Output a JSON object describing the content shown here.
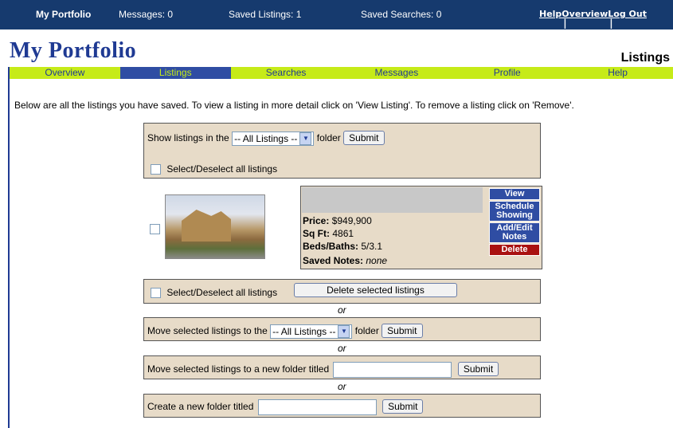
{
  "topbar": {
    "brand": "My Portfolio",
    "messages": "Messages: 0",
    "saved_listings": "Saved Listings: 1",
    "saved_searches": "Saved Searches: 0",
    "help": "Help",
    "overview": "Overview",
    "logout": "Log Out",
    "sep": "|"
  },
  "page": {
    "title": "My Portfolio",
    "section": "Listings"
  },
  "nav": [
    "Overview",
    "Listings",
    "Searches",
    "Messages",
    "Profile",
    "Help"
  ],
  "intro": "Below are all the listings you have saved. To view a listing in more detail click on 'View Listing'. To remove a listing click on 'Remove'.",
  "filter": {
    "prefix": "Show listings in the",
    "select_value": "-- All Listings --",
    "suffix": "folder",
    "submit": "Submit",
    "select_all": "Select/Deselect all listings"
  },
  "listing": {
    "price_label": "Price:",
    "price": "$949,900",
    "sqft_label": "Sq Ft:",
    "sqft": "4861",
    "beds_label": "Beds/Baths:",
    "beds": "5/3.1",
    "notes_label": "Saved Notes:",
    "notes": "none",
    "actions": {
      "view": "View",
      "schedule": "Schedule Showing",
      "notes": "Add/Edit Notes",
      "delete": "Delete"
    }
  },
  "bulk": {
    "select_all": "Select/Deselect all listings",
    "delete_button": "Delete selected listings",
    "or": "or",
    "move_prefix": "Move selected listings to the",
    "move_select": "-- All Listings --",
    "move_suffix": "folder",
    "move_submit": "Submit",
    "new_folder_prefix": "Move selected listings to a new folder titled",
    "new_folder_submit": "Submit",
    "create_prefix": "Create a new folder titled",
    "create_submit": "Submit"
  },
  "colors": {
    "header": "#163a6e",
    "nav": "#c6eb18",
    "nav_active": "#2f4da3",
    "panel": "#e7dbc8",
    "delete": "#a91111"
  }
}
